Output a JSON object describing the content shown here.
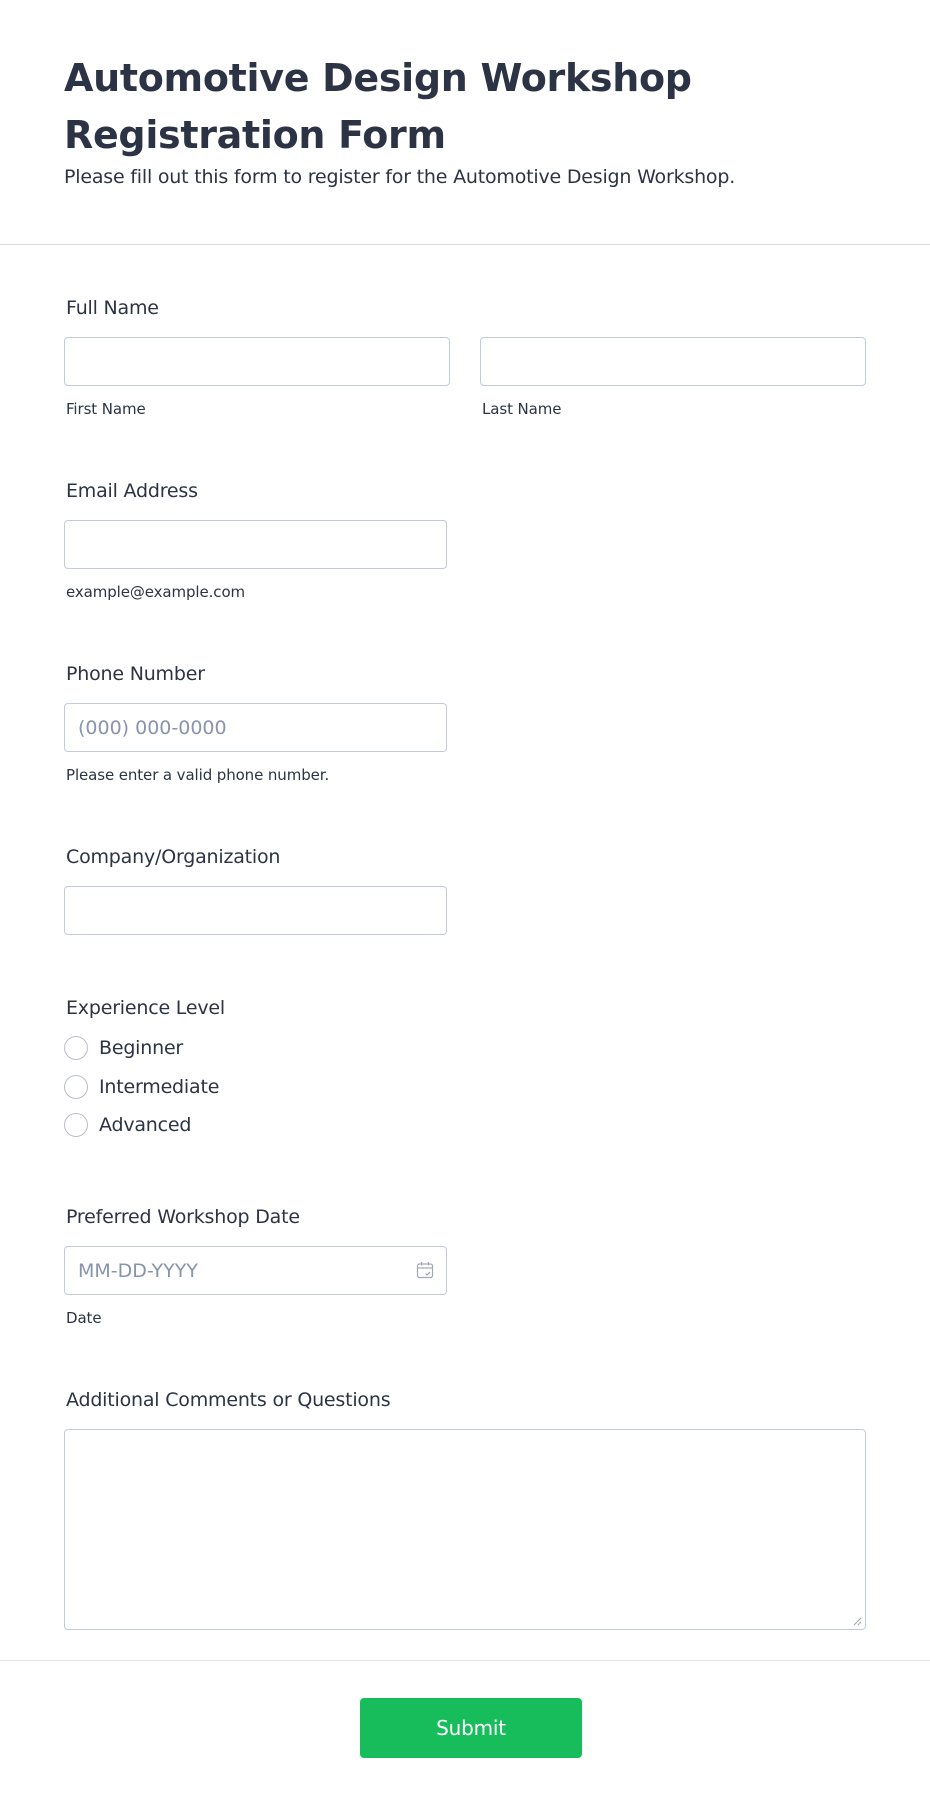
{
  "header": {
    "title": "Automotive Design Workshop Registration Form",
    "subtitle": "Please fill out this form to register for the Automotive Design Workshop."
  },
  "fields": {
    "full_name": {
      "label": "Full Name",
      "first_sublabel": "First Name",
      "last_sublabel": "Last Name"
    },
    "email": {
      "label": "Email Address",
      "sublabel": "example@example.com"
    },
    "phone": {
      "label": "Phone Number",
      "placeholder": "(000) 000-0000",
      "sublabel": "Please enter a valid phone number."
    },
    "company": {
      "label": "Company/Organization"
    },
    "experience": {
      "label": "Experience Level",
      "options": [
        "Beginner",
        "Intermediate",
        "Advanced"
      ]
    },
    "date": {
      "label": "Preferred Workshop Date",
      "placeholder": "MM-DD-YYYY",
      "sublabel": "Date",
      "icon": "calendar-icon"
    },
    "comments": {
      "label": "Additional Comments or Questions"
    }
  },
  "submit": {
    "label": "Submit",
    "color": "#18bd5b"
  }
}
